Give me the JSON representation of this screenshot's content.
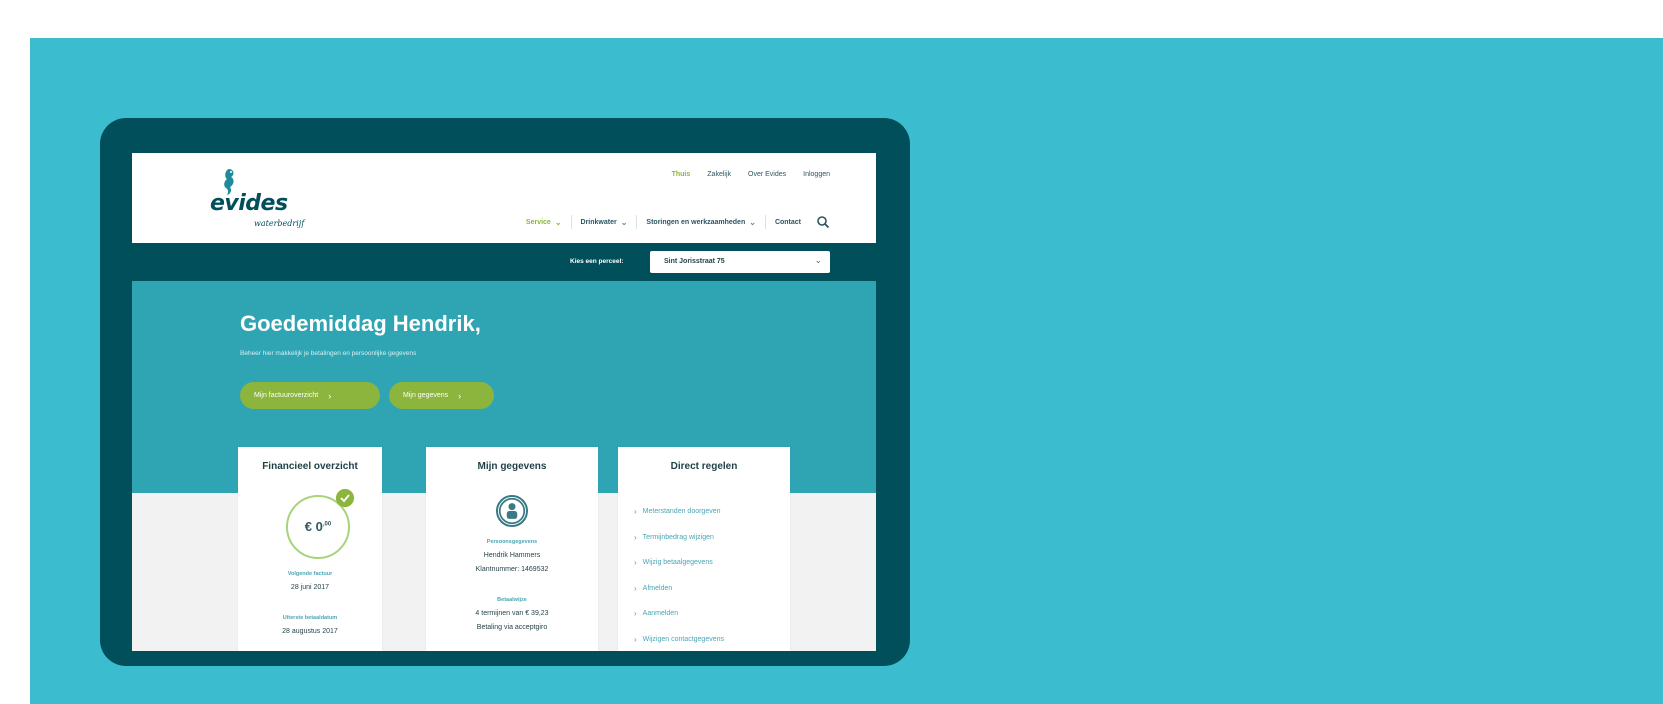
{
  "brand": {
    "logo_word": "evides",
    "logo_sub": "waterbedrijf",
    "colors": {
      "teal": "#3bbccf",
      "dark": "#004f5a",
      "green": "#8bb53c",
      "hero": "#2fa5b3"
    }
  },
  "topnav": [
    "Thuis",
    "Zakelijk",
    "Over Evides",
    "Inloggen"
  ],
  "mainnav": [
    {
      "label": "Service",
      "icon": "chevron-down-icon"
    },
    {
      "label": "Drinkwater",
      "icon": "chevron-down-icon"
    },
    {
      "label": "Storingen en werkzaamheden",
      "icon": "chevron-down-icon"
    },
    {
      "label": "Contact"
    }
  ],
  "perceel": {
    "label": "Kies een perceel:",
    "value": "Sint Jorisstraat 75"
  },
  "hero": {
    "greeting": "Goedemiddag Hendrik,",
    "subtext": "Beheer hier makkelijk je betalingen en persoonlijke gegevens",
    "btn1": "Mijn factuuroverzicht",
    "btn2": "Mijn gegevens"
  },
  "cards": {
    "financieel": {
      "title": "Financieel overzicht",
      "amount": "€ 0",
      "amount_cents": ",00",
      "next_label": "Volgende factuur",
      "next_value": "28 juni 2017",
      "due_label": "Uiterste betaaldatum",
      "due_value": "28 augustus 2017"
    },
    "gegevens": {
      "title": "Mijn gegevens",
      "persoon_label": "Persoonsgegevens",
      "name": "Hendrik Hammers",
      "klant": "Klantnummer: 1469532",
      "betaal_label": "Betaalwijze",
      "termijn": "4 termijnen van € 39,23",
      "betaling": "Betaling via acceptgiro"
    },
    "direct": {
      "title": "Direct regelen",
      "links": [
        "Meterstanden doorgeven",
        "Termijnbedrag wijzigen",
        "Wijzig betaalgegevens",
        "Afmelden",
        "Aanmelden",
        "Wijzigen contactgegevens"
      ]
    }
  }
}
